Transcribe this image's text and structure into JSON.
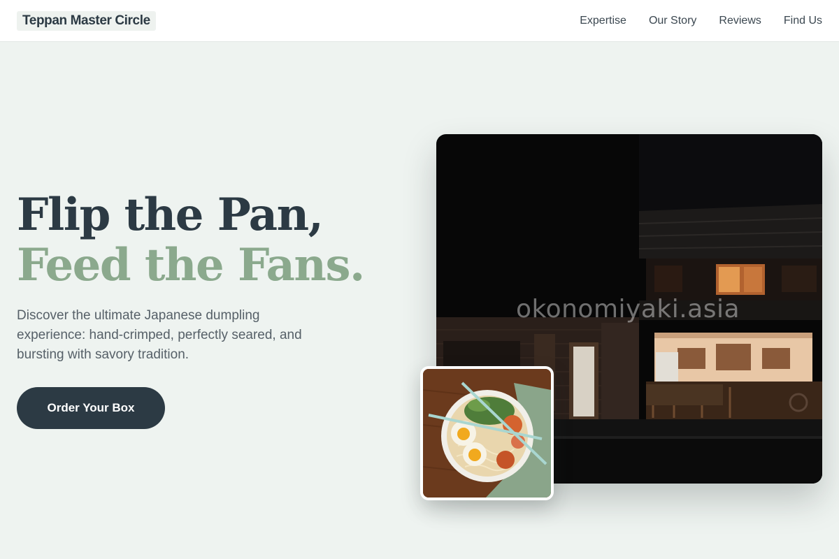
{
  "header": {
    "brand": "Teppan Master Circle",
    "nav": [
      {
        "label": "Expertise"
      },
      {
        "label": "Our Story"
      },
      {
        "label": "Reviews"
      },
      {
        "label": "Find Us"
      }
    ]
  },
  "hero": {
    "title_line1": "Flip the Pan,",
    "title_line2": "Feed the Fans.",
    "description": "Discover the ultimate Japanese dumpling experience: hand-crimped, perfectly seared, and bursting with savory tradition.",
    "cta_label": "Order Your Box"
  },
  "media": {
    "main_photo_watermark": "okonomiyaki.asia",
    "main_photo_icon": "night-restaurant-storefront",
    "thumb_icon": "ramen-bowl-with-egg"
  },
  "colors": {
    "background": "#eef3f0",
    "dark": "#2c3a44",
    "accent_green": "#8ba98d"
  }
}
